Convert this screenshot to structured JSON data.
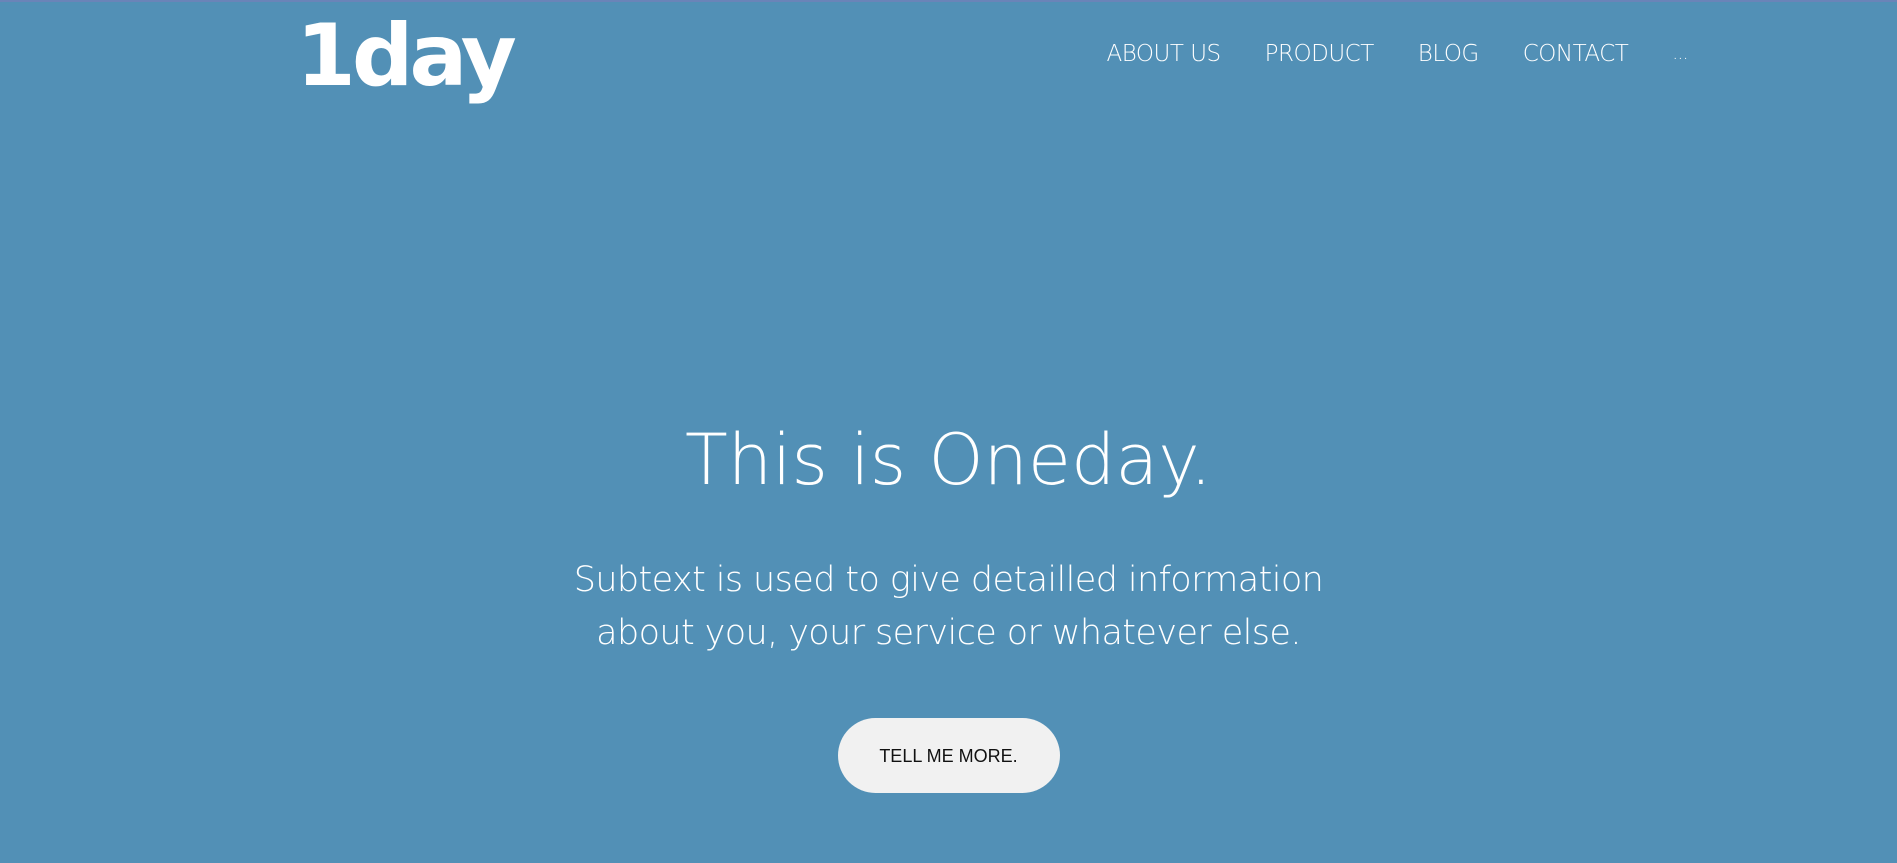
{
  "header": {
    "logo_text": "1day",
    "nav": [
      {
        "label": "ABOUT US"
      },
      {
        "label": "PRODUCT"
      },
      {
        "label": "BLOG"
      },
      {
        "label": "CONTACT"
      },
      {
        "label": "..."
      }
    ]
  },
  "hero": {
    "title": "This is Oneday.",
    "subtext_line1": "Subtext is used to give detailled information",
    "subtext_line2": "about you, your service or whatever else.",
    "cta_label": "TELL ME MORE."
  },
  "colors": {
    "background": "#5290b6",
    "top_border": "#6a84b8",
    "text": "#ffffff",
    "button_bg": "#f1f1f1",
    "button_text": "#111111"
  }
}
